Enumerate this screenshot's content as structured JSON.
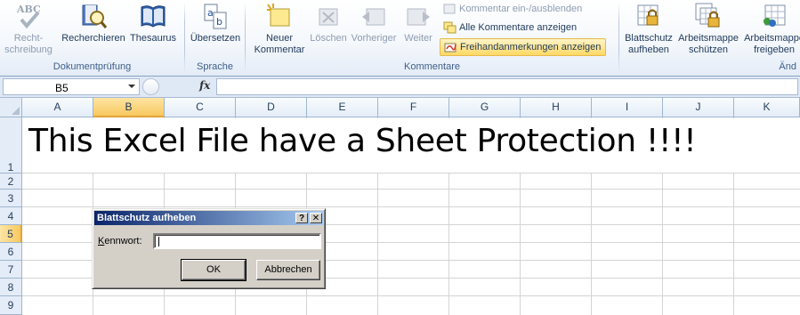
{
  "ribbon": {
    "groups": {
      "proofing": {
        "label": "Dokumentprüfung",
        "spelling": {
          "line1": "Recht-",
          "line2": "schreibung",
          "icon": "spellcheck-abc-icon"
        },
        "research": {
          "label": "Recherchieren",
          "icon": "research-book-icon"
        },
        "thesaurus": {
          "label": "Thesaurus",
          "icon": "thesaurus-book-icon"
        }
      },
      "language": {
        "label": "Sprache",
        "translate": {
          "label": "Übersetzen",
          "icon": "translate-icon"
        }
      },
      "comments": {
        "label": "Kommentare",
        "new": {
          "line1": "Neuer",
          "line2": "Kommentar",
          "icon": "new-comment-icon"
        },
        "delete": {
          "label": "Löschen",
          "icon": "delete-comment-icon"
        },
        "previous": {
          "label": "Vorheriger",
          "icon": "previous-comment-icon"
        },
        "next": {
          "label": "Weiter",
          "icon": "next-comment-icon"
        },
        "toggle": {
          "label": "Kommentar ein-/ausblenden",
          "icon": "show-comment-icon"
        },
        "show_all": {
          "label": "Alle Kommentare anzeigen",
          "icon": "show-all-comments-icon"
        },
        "ink": {
          "label": "Freihandanmerkungen anzeigen",
          "icon": "ink-annotations-icon"
        }
      },
      "changes": {
        "label": "Änd",
        "unprotect_sheet": {
          "line1": "Blattschutz",
          "line2": "aufheben",
          "icon": "unprotect-sheet-lock-icon"
        },
        "protect_workbook": {
          "line1": "Arbeitsmappe",
          "line2": "schützen",
          "icon": "protect-workbook-lock-icon"
        },
        "share_workbook": {
          "line1": "Arbeitsmappe",
          "line2": "freigeben",
          "icon": "share-workbook-icon"
        }
      }
    }
  },
  "formula_bar": {
    "name_box": "B5",
    "fx": "fx",
    "formula": ""
  },
  "sheet": {
    "columns": [
      "A",
      "B",
      "C",
      "D",
      "E",
      "F",
      "G",
      "H",
      "I",
      "J",
      "K"
    ],
    "rows": [
      "1",
      "2",
      "3",
      "4",
      "5",
      "6",
      "7",
      "8",
      "9"
    ],
    "selected_cell": "B5",
    "cell_A1": "This Excel File have a Sheet Protection !!!!"
  },
  "dialog": {
    "title": "Blattschutz aufheben",
    "help_button": "?",
    "close_button": "✕",
    "password_label_accel": "K",
    "password_label_rest": "ennwort:",
    "password_value": "",
    "ok_label": "OK",
    "cancel_label": "Abbrechen"
  },
  "colors": {
    "ribbon_text": "#1e395b",
    "header_bg": "#e4ecf7",
    "selection_header": "#f8c860",
    "dialog_title": "#0a246a"
  }
}
